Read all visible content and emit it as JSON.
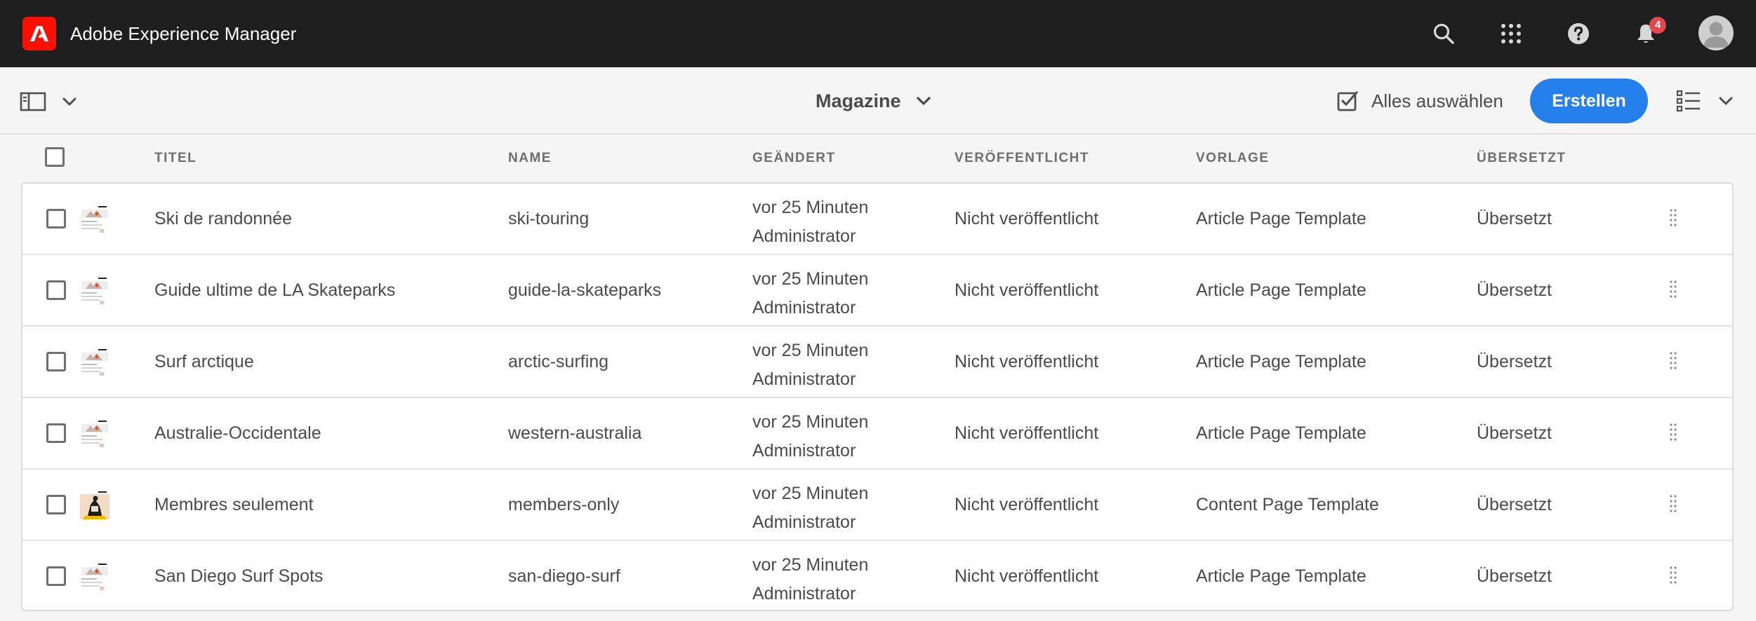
{
  "app": {
    "title": "Adobe Experience Manager",
    "brand_color": "#fa0f00",
    "notification_count": "4"
  },
  "shell_icons": [
    "search-icon",
    "apps-grid-icon",
    "help-icon",
    "bell-icon",
    "user-avatar"
  ],
  "actionbar": {
    "collection_title": "Magazine",
    "select_all_label": "Alles auswählen",
    "create_label": "Erstellen",
    "accent_color": "#2680eb"
  },
  "columns": {
    "title": "TITEL",
    "name": "NAME",
    "modified": "GEÄNDERT",
    "published": "VERÖFFENTLICHT",
    "template": "VORLAGE",
    "translated": "ÜBERSETZT"
  },
  "rows": [
    {
      "title": "Ski de randonnée",
      "name": "ski-touring",
      "modified_time": "vor 25 Minuten",
      "modified_by": "Administrator",
      "published": "Nicht veröffentlicht",
      "template": "Article Page Template",
      "translated": "Übersetzt"
    },
    {
      "title": "Guide ultime de LA Skateparks",
      "name": "guide-la-skateparks",
      "modified_time": "vor 25 Minuten",
      "modified_by": "Administrator",
      "published": "Nicht veröffentlicht",
      "template": "Article Page Template",
      "translated": "Übersetzt"
    },
    {
      "title": "Surf arctique",
      "name": "arctic-surfing",
      "modified_time": "vor 25 Minuten",
      "modified_by": "Administrator",
      "published": "Nicht veröffentlicht",
      "template": "Article Page Template",
      "translated": "Übersetzt"
    },
    {
      "title": "Australie-Occidentale",
      "name": "western-australia",
      "modified_time": "vor 25 Minuten",
      "modified_by": "Administrator",
      "published": "Nicht veröffentlicht",
      "template": "Article Page Template",
      "translated": "Übersetzt"
    },
    {
      "title": "Membres seulement",
      "name": "members-only",
      "modified_time": "vor 25 Minuten",
      "modified_by": "Administrator",
      "published": "Nicht veröffentlicht",
      "template": "Content Page Template",
      "translated": "Übersetzt"
    },
    {
      "title": "San Diego Surf Spots",
      "name": "san-diego-surf",
      "modified_time": "vor 25 Minuten",
      "modified_by": "Administrator",
      "published": "Nicht veröffentlicht",
      "template": "Article Page Template",
      "translated": "Übersetzt"
    }
  ]
}
